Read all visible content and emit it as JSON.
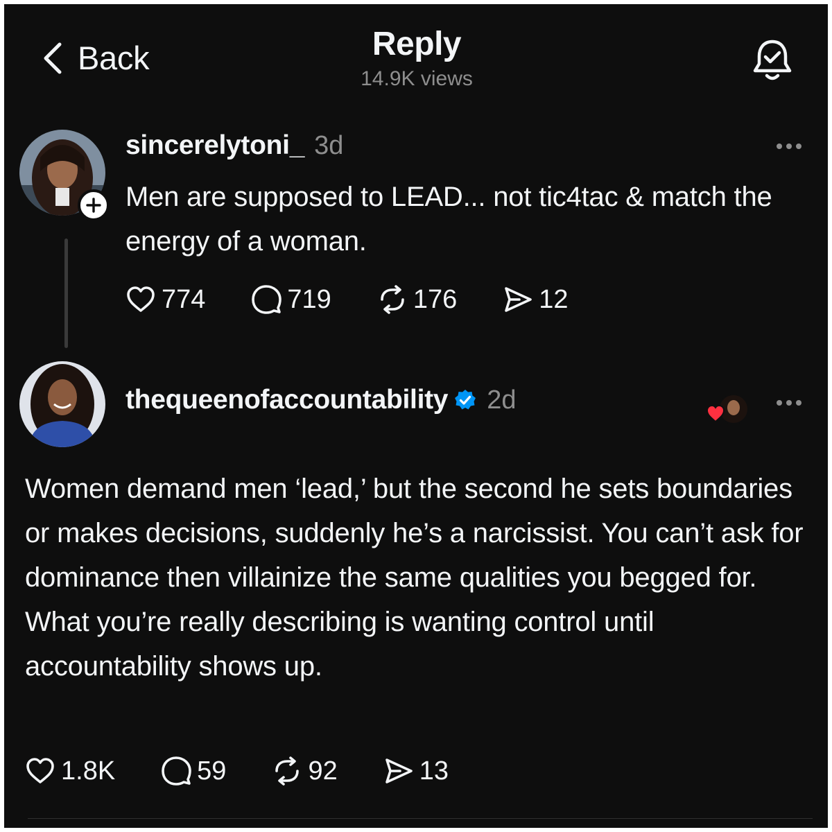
{
  "header": {
    "back_label": "Back",
    "title": "Reply",
    "views": "14.9K views"
  },
  "posts": [
    {
      "username": "sincerelytoni_",
      "time": "3d",
      "verified": false,
      "text": "Men are supposed to LEAD... not tic4tac & match the energy of a woman.",
      "stats": {
        "likes": "774",
        "replies": "719",
        "reposts": "176",
        "shares": "12"
      }
    },
    {
      "username": "thequeenofaccountability",
      "time": "2d",
      "verified": true,
      "text": "Women demand men ‘lead,’ but the second he sets boundaries or makes decisions, suddenly he’s a narcissist. You can’t ask for dominance then villainize the same qualities you begged for. What you’re really describing is wanting control until accountability shows up.",
      "stats": {
        "likes": "1.8K",
        "replies": "59",
        "reposts": "92",
        "shares": "13"
      }
    }
  ],
  "icons": {
    "back": "chevron-left-icon",
    "notify": "bell-check-icon",
    "like": "heart-icon",
    "reply": "comment-icon",
    "repost": "repost-icon",
    "share": "send-icon",
    "more": "more-horizontal-icon",
    "verified": "verified-badge-icon",
    "follow": "plus-icon"
  },
  "colors": {
    "background": "#0e0e0e",
    "text": "#f3f5f7",
    "muted": "#8e8e8e",
    "verified": "#0095f6",
    "heart": "#ff3040"
  }
}
